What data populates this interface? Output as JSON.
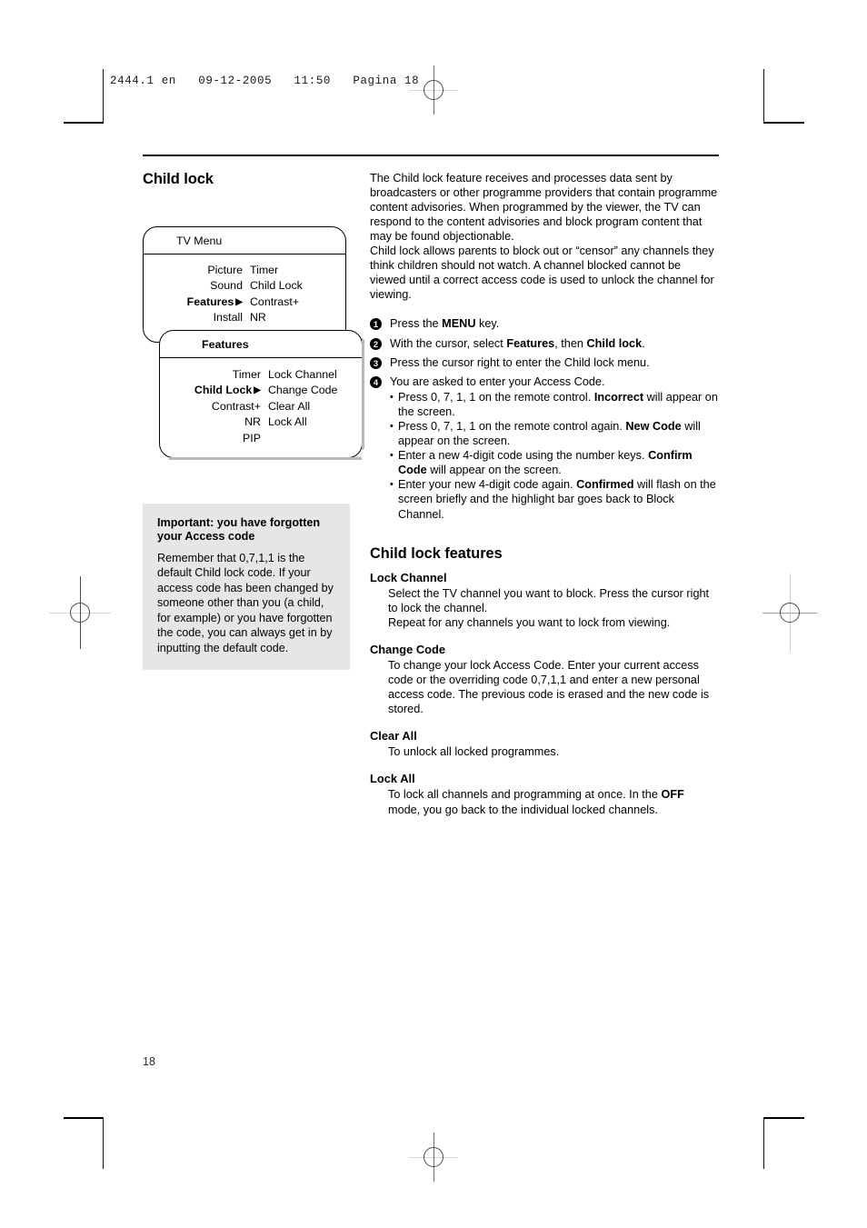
{
  "prepress": {
    "slug": "2444.1 en   09-12-2005   11:50   Pagina 18"
  },
  "page": {
    "folio": "18"
  },
  "section": {
    "title": "Child lock"
  },
  "diagram": {
    "tv_menu": {
      "header": "TV Menu",
      "left_column": [
        "Picture",
        "Sound",
        "Features",
        "Install"
      ],
      "left_highlight_index": 2,
      "right_column": [
        "Timer",
        "Child Lock",
        "Contrast+",
        "NR"
      ]
    },
    "features_menu": {
      "header": "Features",
      "left_column": [
        "Timer",
        "Child Lock",
        "Contrast+",
        "NR",
        "PIP"
      ],
      "left_highlight_index": 1,
      "right_column": [
        "Lock Channel",
        "Change Code",
        "Clear All",
        "Lock All"
      ]
    },
    "arrow_glyph": "▶"
  },
  "important_box": {
    "title": "Important: you have forgotten your Access code",
    "body": "Remember that 0,7,1,1 is the default Child lock code. If your access code has been changed by someone other than you (a child, for example) or you have forgotten the code, you can always get in by inputting the default code.",
    "background_color": "#e6e6e6"
  },
  "intro": {
    "paragraph_1": "The Child lock feature receives and processes data sent by broadcasters or other programme providers that contain programme content advisories. When programmed by the viewer, the TV can respond to the content advisories and block program content that may be found objectionable.",
    "paragraph_2": "Child lock allows parents to block out or “censor” any channels they think children should not watch. A channel blocked cannot be viewed until a correct access code is used to unlock the channel for viewing."
  },
  "steps": [
    {
      "num": "1",
      "html": "Press the <b>MENU</b> key."
    },
    {
      "num": "2",
      "html": "With the cursor, select <b>Features</b>, then <b>Child lock</b>."
    },
    {
      "num": "3",
      "html": "Press the cursor right to enter the Child lock menu."
    },
    {
      "num": "4",
      "html": "You are asked to enter your Access Code.",
      "sub": [
        "Press 0, 7, 1, 1 on the remote control. <b>Incorrect</b> will appear on the screen.",
        "Press 0, 7, 1, 1 on the remote control again. <b>New Code</b> will appear on the screen.",
        "Enter a new 4-digit code using the number keys. <b>Confirm Code</b> will appear on the screen.",
        "Enter your new 4-digit code again. <b>Confirmed</b> will flash on the screen briefly and the highlight bar goes back to Block Channel."
      ]
    }
  ],
  "features_section": {
    "title": "Child lock features",
    "items": [
      {
        "heading": "Lock Channel",
        "body": "Select the TV channel you want to block. Press the cursor right to lock the channel.<br>Repeat for any channels you want to lock from viewing."
      },
      {
        "heading": "Change Code",
        "body": "To change your lock Access Code. Enter your current access code or the overriding code 0,7,1,1 and enter a new personal access code. The previous code is erased and the new code is stored."
      },
      {
        "heading": "Clear All",
        "body": "To unlock all locked programmes."
      },
      {
        "heading": "Lock All",
        "body": "To lock all channels and programming at once. In the <b>OFF</b> mode, you go back to the individual locked channels."
      }
    ]
  }
}
